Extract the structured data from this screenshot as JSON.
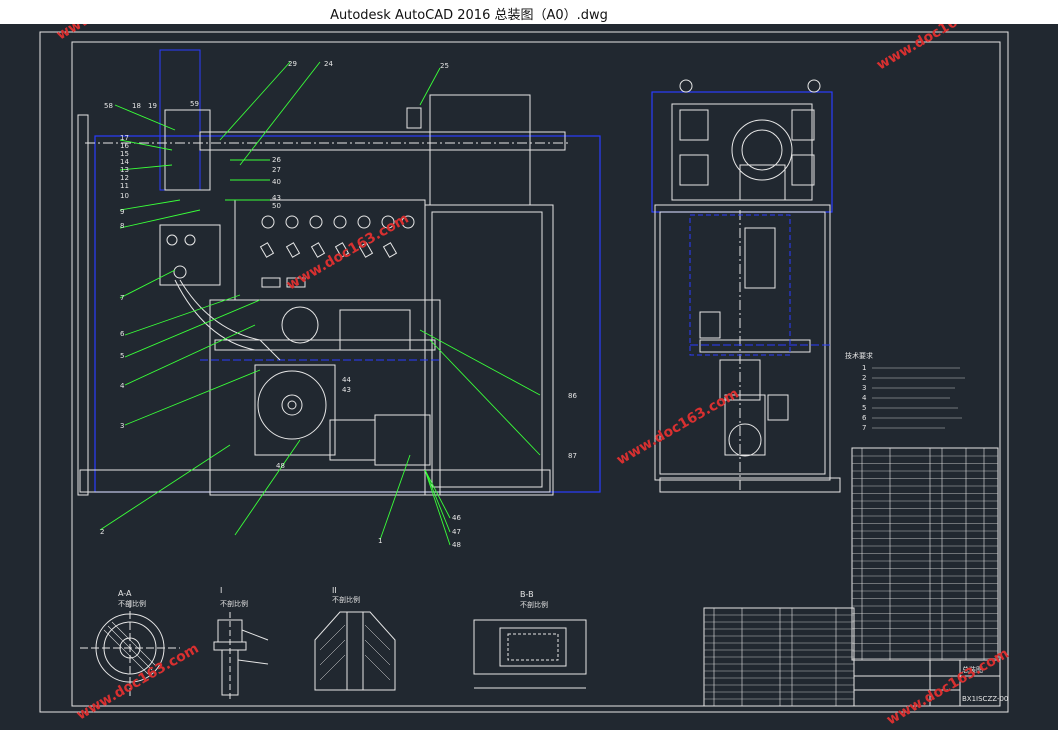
{
  "window": {
    "title": "Autodesk AutoCAD 2016    总装图（A0）.dwg"
  },
  "colors": {
    "background": "#212830",
    "frame": "#e6e6e6",
    "blue": "#2a3cff",
    "green": "#39ff39",
    "white": "#e6e6e6",
    "watermark": "#d83030"
  },
  "watermark": {
    "text": "www.doc163.com"
  },
  "section_views": [
    {
      "id": "AA",
      "title": "A-A",
      "sub": "不剖比例"
    },
    {
      "id": "I",
      "title": "I",
      "sub": "不剖比例"
    },
    {
      "id": "II",
      "title": "II",
      "sub": "不剖比例"
    },
    {
      "id": "BB",
      "title": "B-B",
      "sub": "不剖比例"
    }
  ],
  "callouts_left": [
    "58",
    "18",
    "19",
    "17",
    "16",
    "15",
    "14",
    "13",
    "12",
    "11",
    "10",
    "9",
    "8",
    "7",
    "6",
    "5",
    "4",
    "3",
    "2",
    "1"
  ],
  "callouts_right": [
    "59",
    "24",
    "25",
    "29",
    "26",
    "27",
    "40",
    "43",
    "50",
    "86",
    "87",
    "44",
    "43",
    "48",
    "46",
    "47",
    "48"
  ],
  "tech_req_header": "技术要求",
  "tech_req_numbers": [
    "1",
    "2",
    "3",
    "4",
    "5",
    "6",
    "7"
  ],
  "title_block": {
    "drawing_no": "BX1ISCZZ-00",
    "name": "总装图"
  }
}
